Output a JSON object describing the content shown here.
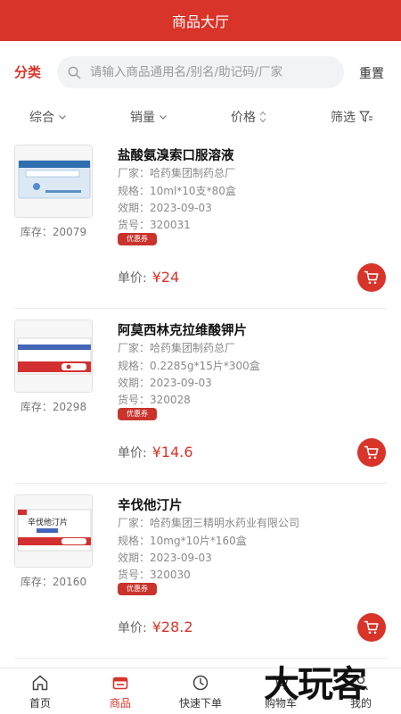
{
  "header": {
    "title": "商品大厅"
  },
  "search": {
    "category_label": "分类",
    "placeholder": "请输入商品通用名/别名/助记码/厂家",
    "value": "",
    "reset_label": "重置"
  },
  "filters": {
    "composite": "综合",
    "sales": "销量",
    "price": "价格",
    "filter": "筛选"
  },
  "products": [
    {
      "name": "盐酸氨溴索口服溶液",
      "manufacturer": "厂家：哈药集团制药总厂",
      "spec": "规格：10ml*10支*80盒",
      "expiry": "效期：2023-09-03",
      "sku": "货号：320031",
      "coupon": "优惠券",
      "stock": "库存：20079",
      "price_label": "单价:",
      "price": "¥24"
    },
    {
      "name": "阿莫西林克拉维酸钾片",
      "manufacturer": "厂家：哈药集团制药总厂",
      "spec": "规格：0.2285g*15片*300盒",
      "expiry": "效期：2023-09-03",
      "sku": "货号：320028",
      "coupon": "优惠券",
      "stock": "库存：20298",
      "price_label": "单价:",
      "price": "¥14.6"
    },
    {
      "name": "辛伐他汀片",
      "manufacturer": "厂家：哈药集团三精明水药业有限公司",
      "spec": "规格：10mg*10片*160盒",
      "expiry": "效期：2023-09-03",
      "sku": "货号：320030",
      "coupon": "优惠券",
      "stock": "库存：20160",
      "price_label": "单价:",
      "price": "¥28.2",
      "package_text": "辛伐他汀片"
    }
  ],
  "tabbar": {
    "home": "首页",
    "products": "商品",
    "quick_order": "快速下单",
    "cart": "购物车",
    "mine": "我的"
  },
  "watermark": "大玩客",
  "colors": {
    "accent": "#d8342a"
  }
}
